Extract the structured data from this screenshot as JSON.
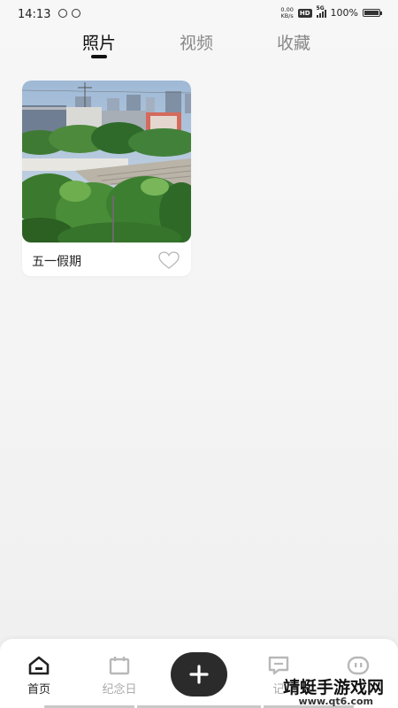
{
  "status": {
    "time": "14:13",
    "speed_value": "0.00",
    "speed_unit": "KB/s",
    "hd": "HD",
    "network": "5G",
    "battery": "100%"
  },
  "tabs": [
    {
      "label": "照片",
      "active": true
    },
    {
      "label": "视频",
      "active": false
    },
    {
      "label": "收藏",
      "active": false
    }
  ],
  "album": {
    "title": "五一假期",
    "favorited": false
  },
  "nav": {
    "home": "首页",
    "anniversary": "纪念日",
    "add_icon": "plus-icon",
    "diary": "记",
    "profile_icon": "face-icon"
  },
  "watermark": {
    "text": "靖蜓手游戏网",
    "url": "www.qt6.com"
  },
  "colors": {
    "active": "#111111",
    "inactive": "#888888",
    "add_button": "#2b2b2b",
    "nav_inactive": "#aaaaaa"
  }
}
